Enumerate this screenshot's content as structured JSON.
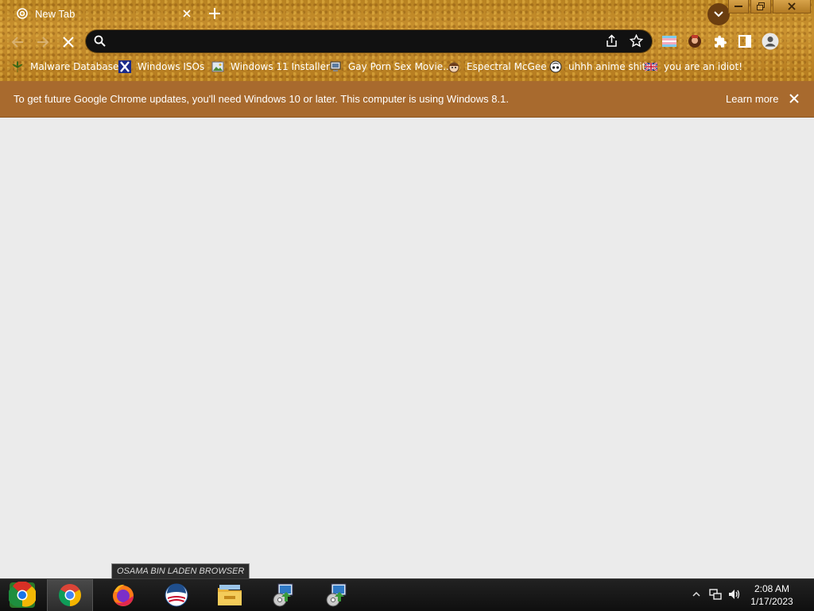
{
  "tab": {
    "title": "New Tab"
  },
  "omnibox": {
    "value": "",
    "placeholder": ""
  },
  "bookmarks": [
    {
      "label": "Malware Database",
      "icon": "cannabis-leaf-icon"
    },
    {
      "label": "Windows ISOs",
      "icon": "x-logo-icon"
    },
    {
      "label": "Windows 11 Installer",
      "icon": "image-icon"
    },
    {
      "label": "Gay Porn Sex Movie...",
      "icon": "computer-icon"
    },
    {
      "label": "Espectral McGee",
      "icon": "face-icon"
    },
    {
      "label": "uhhh anime shit",
      "icon": "anime-face-icon"
    },
    {
      "label": "you are an idiot!",
      "icon": "flag-icon"
    }
  ],
  "infobar": {
    "message": "To get future Google Chrome updates, you'll need Windows 10 or later. This computer is using Windows 8.1.",
    "learn_more": "Learn more"
  },
  "tooltip": {
    "text": "OSAMA BIN LADEN BROWSER"
  },
  "taskbar": {
    "items": [
      "start-button",
      "chrome-icon",
      "firefox-icon",
      "obama-logo-browser-icon",
      "file-explorer-icon",
      "installer-icon",
      "installer-icon"
    ]
  },
  "clock": {
    "time": "2:08 AM",
    "date": "1/17/2023"
  },
  "colors": {
    "chrome_gold": "#b98322",
    "infobar": "#a86a2e",
    "content_bg": "#ebebeb",
    "taskbar": "#1a1a1a"
  }
}
